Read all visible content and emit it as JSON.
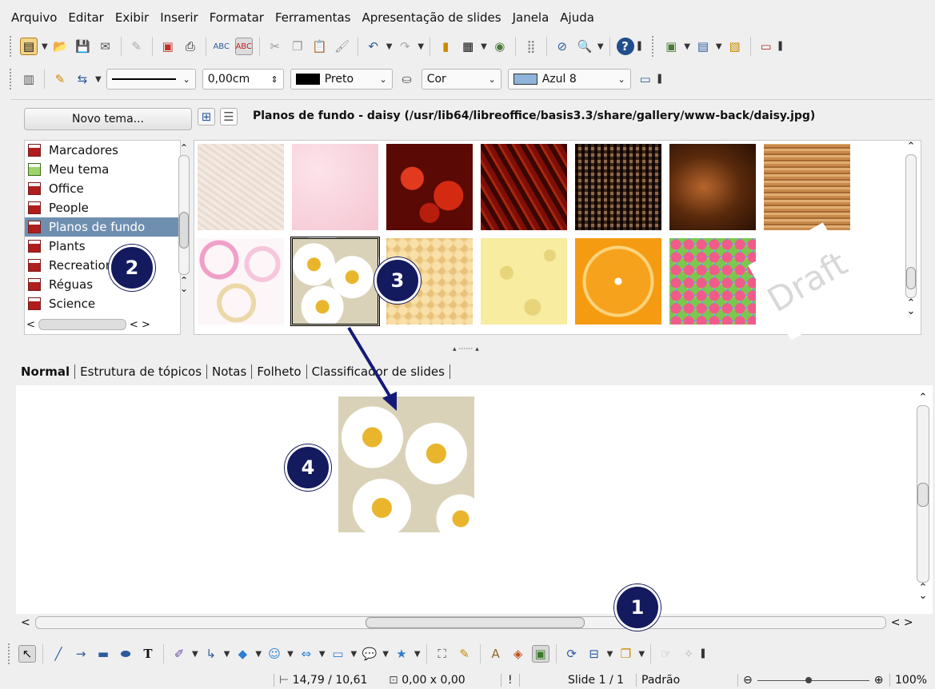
{
  "menu": [
    "Arquivo",
    "Editar",
    "Exibir",
    "Inserir",
    "Formatar",
    "Ferramentas",
    "Apresentação de slides",
    "Janela",
    "Ajuda"
  ],
  "line_toolbar": {
    "width_value": "0,00cm",
    "line_color": "Preto",
    "area_style": "Cor",
    "fill_color": "Azul 8",
    "colors": {
      "line": "#000000",
      "fill": "#8fb3d9"
    }
  },
  "gallery": {
    "new_theme_label": "Novo tema...",
    "title": "Planos de fundo - daisy (/usr/lib64/libreoffice/basis3.3/share/gallery/www-back/daisy.jpg)",
    "themes": [
      {
        "label": "Marcadores",
        "icon": "gallery-theme-icon"
      },
      {
        "label": "Meu tema",
        "icon": "gallery-theme-new-icon"
      },
      {
        "label": "Office",
        "icon": "gallery-theme-icon"
      },
      {
        "label": "People",
        "icon": "gallery-theme-icon"
      },
      {
        "label": "Planos de fundo",
        "icon": "gallery-theme-icon",
        "selected": true
      },
      {
        "label": "Plants",
        "icon": "gallery-theme-icon"
      },
      {
        "label": "Recreation",
        "icon": "gallery-theme-icon"
      },
      {
        "label": "Réguas",
        "icon": "gallery-theme-icon"
      },
      {
        "label": "Science",
        "icon": "gallery-theme-icon"
      }
    ],
    "watermark": "Draft"
  },
  "view_tabs": [
    "Normal",
    "Estrutura de tópicos",
    "Notas",
    "Folheto",
    "Classificador de slides"
  ],
  "status": {
    "position": "14,79 / 10,61",
    "size": "0,00 x 0,00",
    "slide": "Slide 1 / 1",
    "layout": "Padrão",
    "zoom": "100%"
  },
  "callouts": [
    "1",
    "2",
    "3",
    "4"
  ]
}
